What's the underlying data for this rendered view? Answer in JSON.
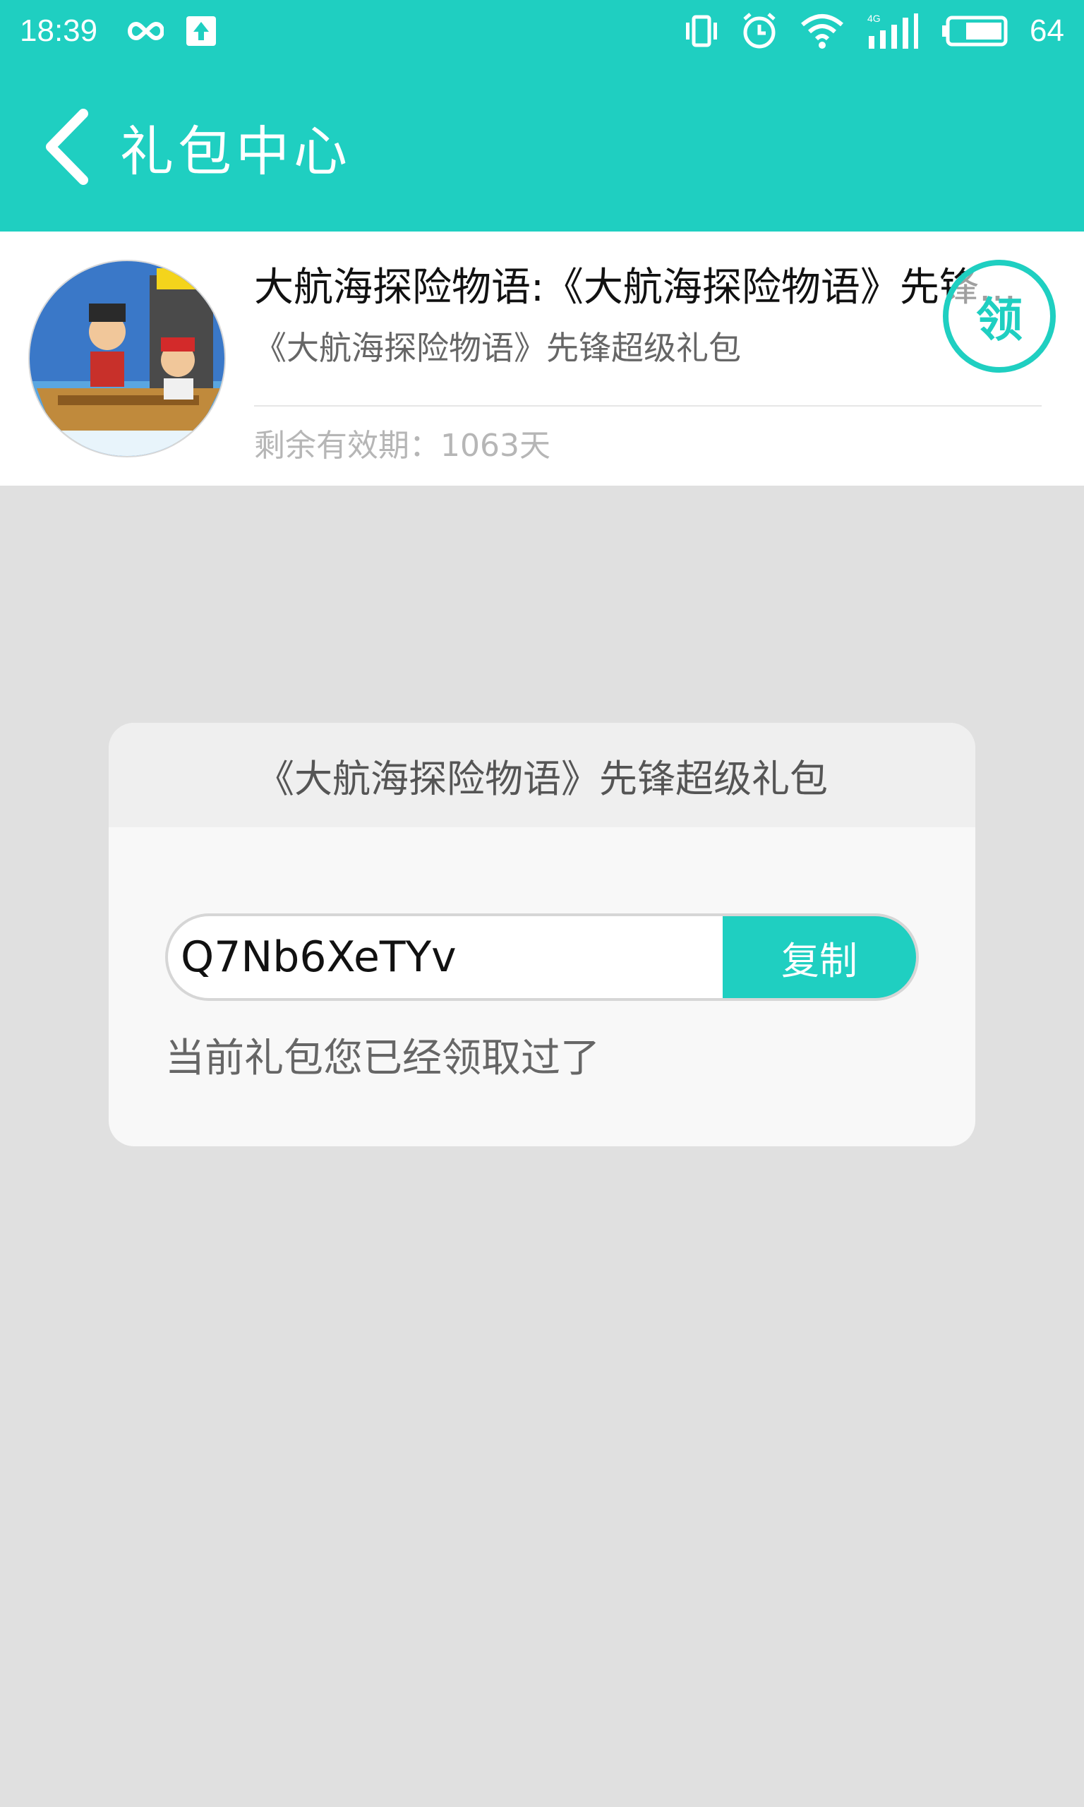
{
  "status_bar": {
    "time": "18:39",
    "battery": "64"
  },
  "app_bar": {
    "title": "礼包中心"
  },
  "gift": {
    "title": "大航海探险物语:《大航海探险物语》先锋...",
    "subtitle": "《大航海探险物语》先锋超级礼包",
    "expiry": "剩余有效期：1063天",
    "claim_label": "领"
  },
  "dialog": {
    "title": "《大航海探险物语》先锋超级礼包",
    "code": "Q7Nb6XeTYv",
    "copy_label": "复制",
    "message": "当前礼包您已经领取过了"
  },
  "colors": {
    "accent": "#1fcfc1",
    "background": "#e0e0e0"
  }
}
